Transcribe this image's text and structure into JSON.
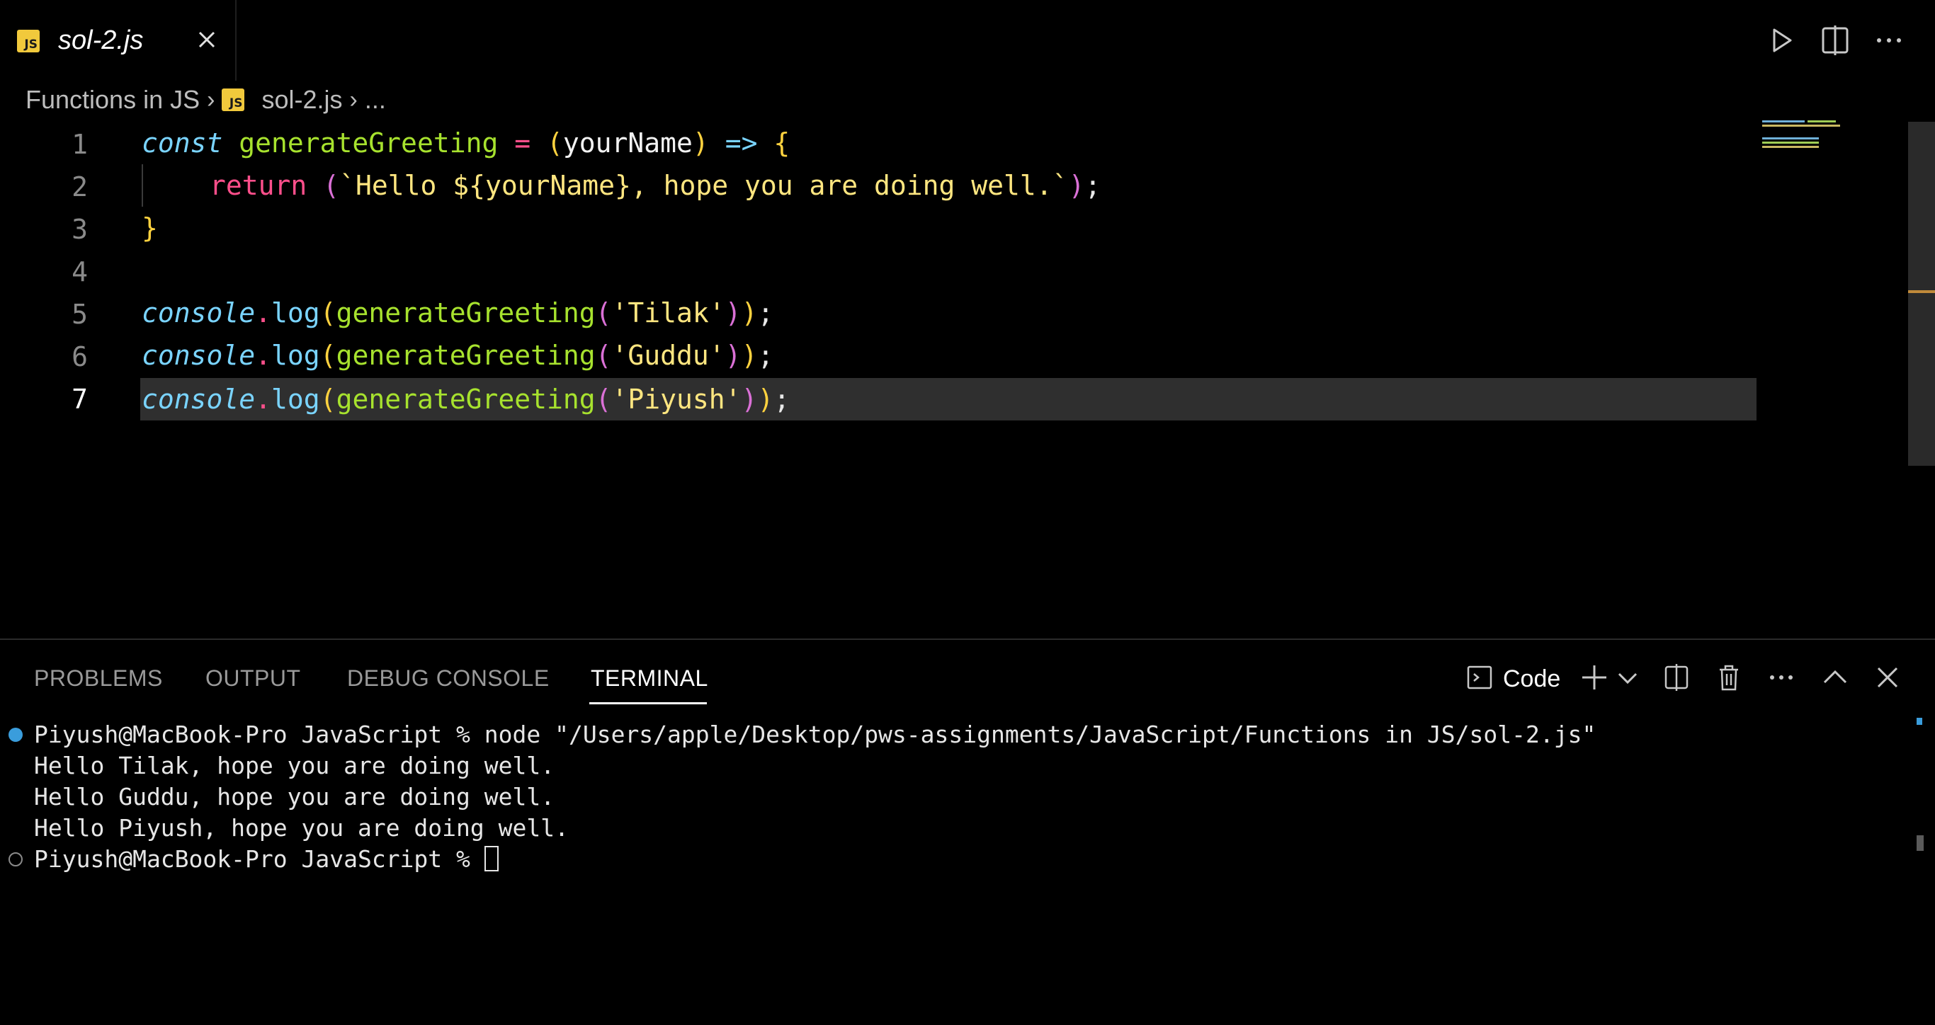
{
  "tab": {
    "label": "sol-2.js",
    "badge": "JS"
  },
  "breadcrumb": {
    "folder": "Functions in JS",
    "file": "sol-2.js",
    "more": "...",
    "badge": "JS"
  },
  "editor": {
    "current_line": 7,
    "line_numbers": [
      "1",
      "2",
      "3",
      "4",
      "5",
      "6",
      "7"
    ],
    "lines": [
      {
        "tokens": [
          "const",
          " ",
          "generateGreeting",
          " ",
          "=",
          " ",
          "(",
          "yourName",
          ")",
          " ",
          "=>",
          " ",
          "{"
        ]
      },
      {
        "tokens": [
          "return",
          " ",
          "(",
          "`Hello ${yourName}, hope you are doing well.`",
          ")",
          ";"
        ]
      },
      {
        "tokens": [
          "}"
        ]
      },
      {
        "tokens": []
      },
      {
        "tokens": [
          "console",
          ".",
          "log",
          "(",
          "generateGreeting",
          "(",
          "'Tilak'",
          ")",
          ")",
          ";"
        ]
      },
      {
        "tokens": [
          "console",
          ".",
          "log",
          "(",
          "generateGreeting",
          "(",
          "'Guddu'",
          ")",
          ")",
          ";"
        ]
      },
      {
        "tokens": [
          "console",
          ".",
          "log",
          "(",
          "generateGreeting",
          "(",
          "'Piyush'",
          ")",
          ")",
          ";"
        ]
      }
    ]
  },
  "panel": {
    "tabs": [
      "PROBLEMS",
      "OUTPUT",
      "DEBUG CONSOLE",
      "TERMINAL"
    ],
    "active_tab": "TERMINAL",
    "terminal_name": "Code",
    "terminal_lines": [
      "Piyush@MacBook-Pro JavaScript % node \"/Users/apple/Desktop/pws-assignments/JavaScript/Functions in JS/sol-2.js\"",
      "Hello Tilak, hope you are doing well.",
      "Hello Guddu, hope you are doing well.",
      "Hello Piyush, hope you are doing well.",
      "Piyush@MacBook-Pro JavaScript % "
    ]
  },
  "colors": {
    "accent_blue": "#3a9ddc",
    "js_badge": "#f1c93c",
    "current_line_bg": "#2f2f2f"
  }
}
